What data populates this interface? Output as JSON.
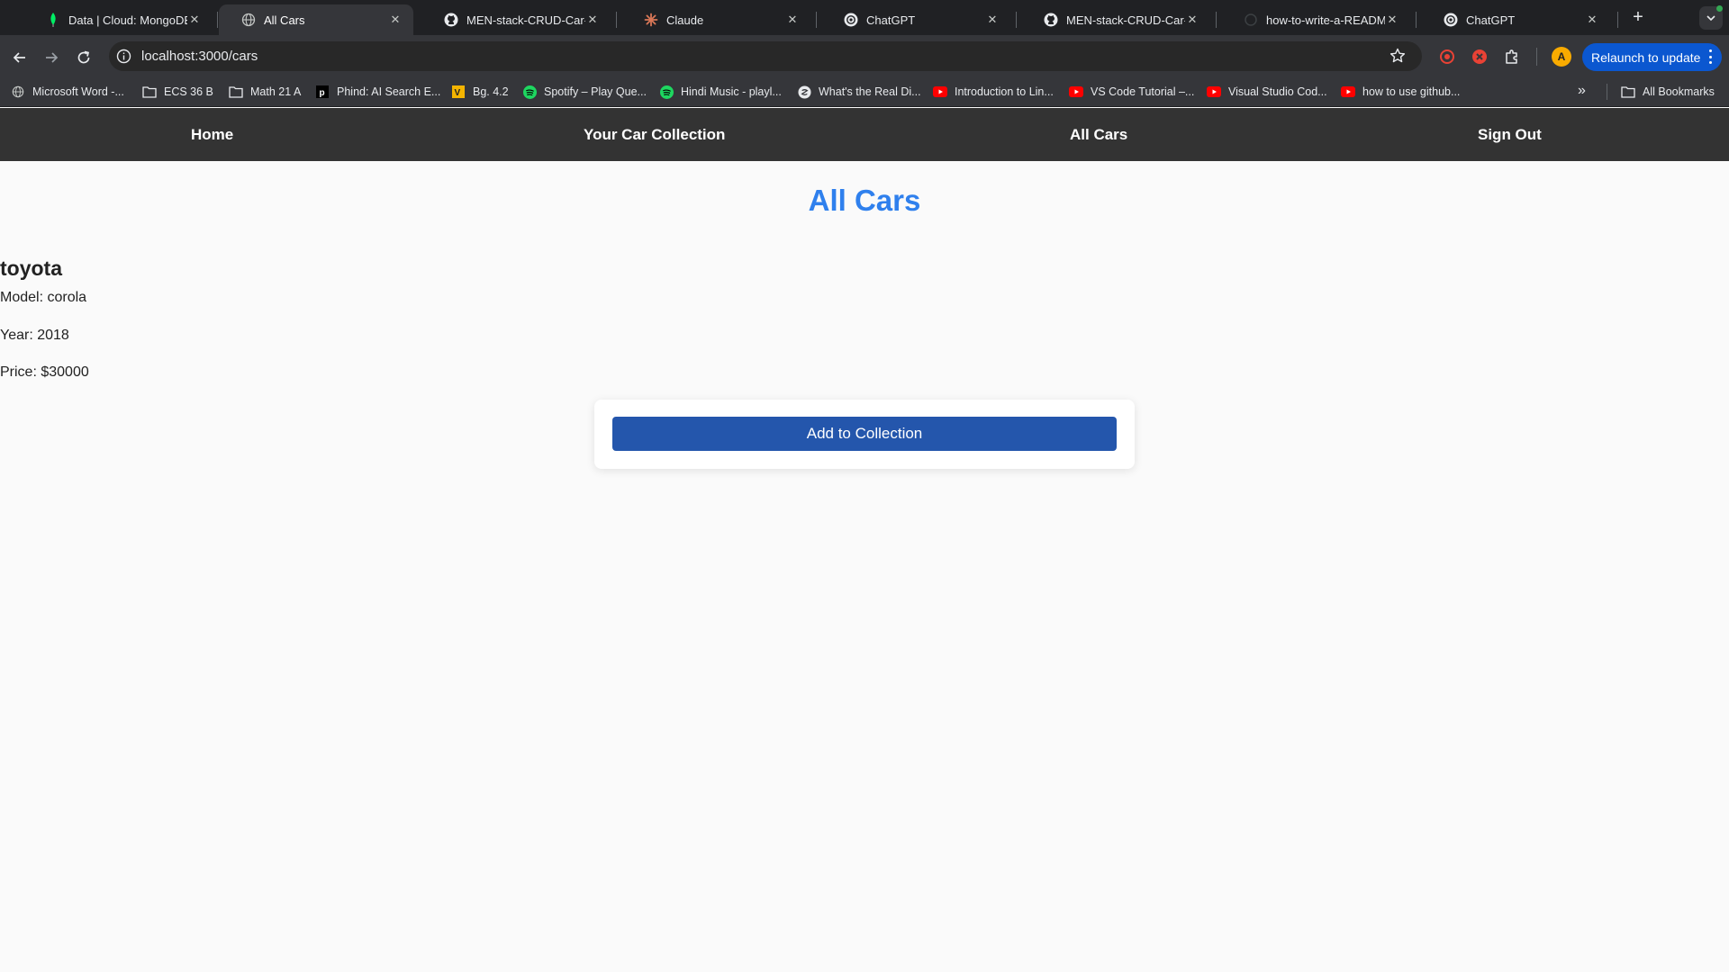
{
  "browser": {
    "tabs": [
      {
        "title": "Data | Cloud: MongoDB Cloud",
        "active": false
      },
      {
        "title": "All Cars",
        "active": true
      },
      {
        "title": "MEN-stack-CRUD-Car-App",
        "active": false
      },
      {
        "title": "Claude",
        "active": false
      },
      {
        "title": "ChatGPT",
        "active": false
      },
      {
        "title": "MEN-stack-CRUD-Car-App",
        "active": false
      },
      {
        "title": "how-to-write-a-README/README",
        "active": false
      },
      {
        "title": "ChatGPT",
        "active": false
      }
    ],
    "url": "localhost:3000/cars",
    "relaunch_label": "Relaunch to update",
    "avatar_letter": "A",
    "bookmarks": [
      {
        "label": "Microsoft Word -...",
        "icon": "globe-icon"
      },
      {
        "label": "ECS 36 B",
        "icon": "folder-icon"
      },
      {
        "label": "Math 21 A",
        "icon": "folder-icon"
      },
      {
        "label": "Phind: AI Search E...",
        "icon": "phind-icon"
      },
      {
        "label": "Bg. 4.2",
        "icon": "vedabase-icon"
      },
      {
        "label": "Spotify – Play Que...",
        "icon": "spotify-icon"
      },
      {
        "label": "Hindi Music - playl...",
        "icon": "spotify-icon"
      },
      {
        "label": "What's the Real Di...",
        "icon": "site-icon"
      },
      {
        "label": "Introduction to Lin...",
        "icon": "youtube-icon"
      },
      {
        "label": "VS Code Tutorial –...",
        "icon": "youtube-icon"
      },
      {
        "label": "Visual Studio Cod...",
        "icon": "youtube-icon"
      },
      {
        "label": "how to use github...",
        "icon": "youtube-icon"
      }
    ],
    "all_bookmarks_label": "All Bookmarks",
    "colors": {
      "tabstrip": "#202124",
      "toolbar": "#35363a",
      "relaunch": "#0b57d0"
    }
  },
  "nav": {
    "home": "Home",
    "collection": "Your Car Collection",
    "all_cars": "All Cars",
    "sign_out": "Sign Out"
  },
  "page": {
    "title": "All Cars",
    "car": {
      "make": "toyota",
      "model": "Model: corola",
      "year": "Year: 2018",
      "price": "Price: $30000"
    },
    "add_button": "Add to Collection",
    "colors": {
      "title": "#2f80ed",
      "button": "#2456ac",
      "nav": "#333333"
    }
  }
}
